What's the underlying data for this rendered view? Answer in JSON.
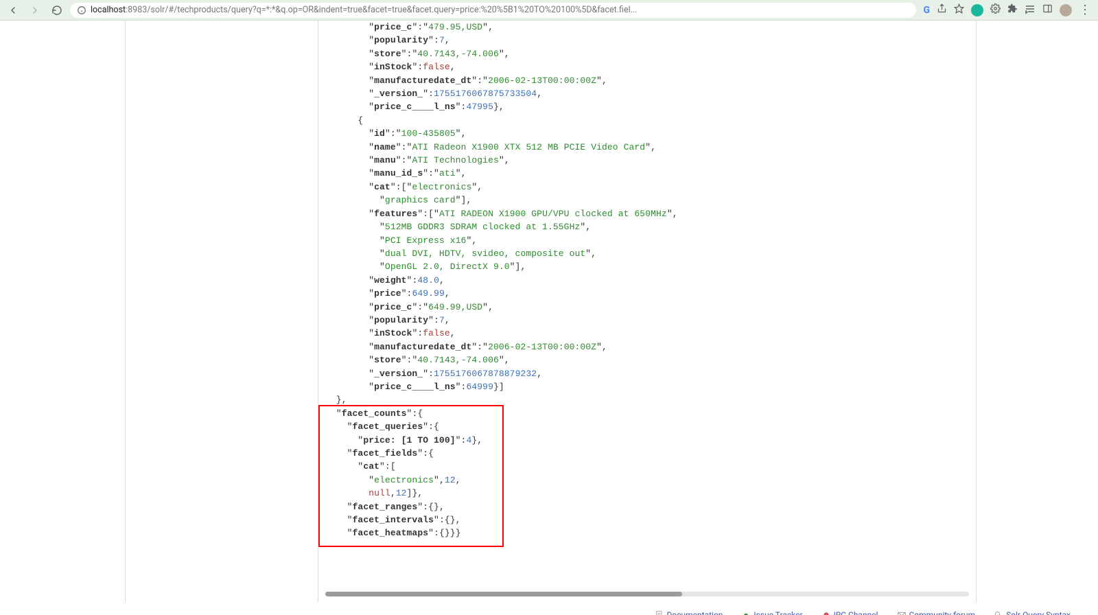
{
  "browser": {
    "url_host": "localhost",
    "url_port": ":8983",
    "url_path": "/solr/#/techproducts/query?q=*:*&q.op=OR&indent=true&facet=true&facet.query=price:%20%5B1%20TO%20100%5D&facet.fiel..."
  },
  "doc0": {
    "price_c": "479.95,USD",
    "popularity": "7",
    "store": "40.7143,-74.006",
    "inStock": "false",
    "manufacturedate_dt": "2006-02-13T00:00:00Z",
    "_version_": "1755176067875733504",
    "price_c____l_ns": "47995"
  },
  "doc1": {
    "id": "100-435805",
    "name": "ATI Radeon X1900 XTX 512 MB PCIE Video Card",
    "manu": "ATI Technologies",
    "manu_id_s": "ati",
    "cat0": "electronics",
    "cat1": "graphics card",
    "feat0": "ATI RADEON X1900 GPU/VPU clocked at 650MHz",
    "feat1": "512MB GDDR3 SDRAM clocked at 1.55GHz",
    "feat2": "PCI Express x16",
    "feat3": "dual DVI, HDTV, svideo, composite out",
    "feat4": "OpenGL 2.0, DirectX 9.0",
    "weight": "48.0",
    "price": "649.99",
    "price_c": "649.99,USD",
    "popularity": "7",
    "inStock": "false",
    "manufacturedate_dt": "2006-02-13T00:00:00Z",
    "store": "40.7143,-74.006",
    "_version_": "1755176067878879232",
    "price_c____l_ns": "64999"
  },
  "facets": {
    "query_key": "price: [1 TO 100]",
    "query_val": "4",
    "field_cat_val0": "electronics",
    "field_cat_cnt0": "12",
    "field_cat_val1": "null",
    "field_cat_cnt1": "12"
  },
  "keys": {
    "price_c": "price_c",
    "popularity": "popularity",
    "store": "store",
    "inStock": "inStock",
    "manufacturedate_dt": "manufacturedate_dt",
    "version": "_version_",
    "price_c_l_ns": "price_c____l_ns",
    "id": "id",
    "name": "name",
    "manu": "manu",
    "manu_id_s": "manu_id_s",
    "cat": "cat",
    "features": "features",
    "weight": "weight",
    "price": "price",
    "facet_counts": "facet_counts",
    "facet_queries": "facet_queries",
    "facet_fields": "facet_fields",
    "facet_ranges": "facet_ranges",
    "facet_intervals": "facet_intervals",
    "facet_heatmaps": "facet_heatmaps"
  },
  "footer": {
    "doc": "Documentation",
    "issue": "Issue Tracker",
    "irc": "IRC Channel",
    "forum": "Community forum",
    "syntax": "Solr Query Syntax"
  }
}
